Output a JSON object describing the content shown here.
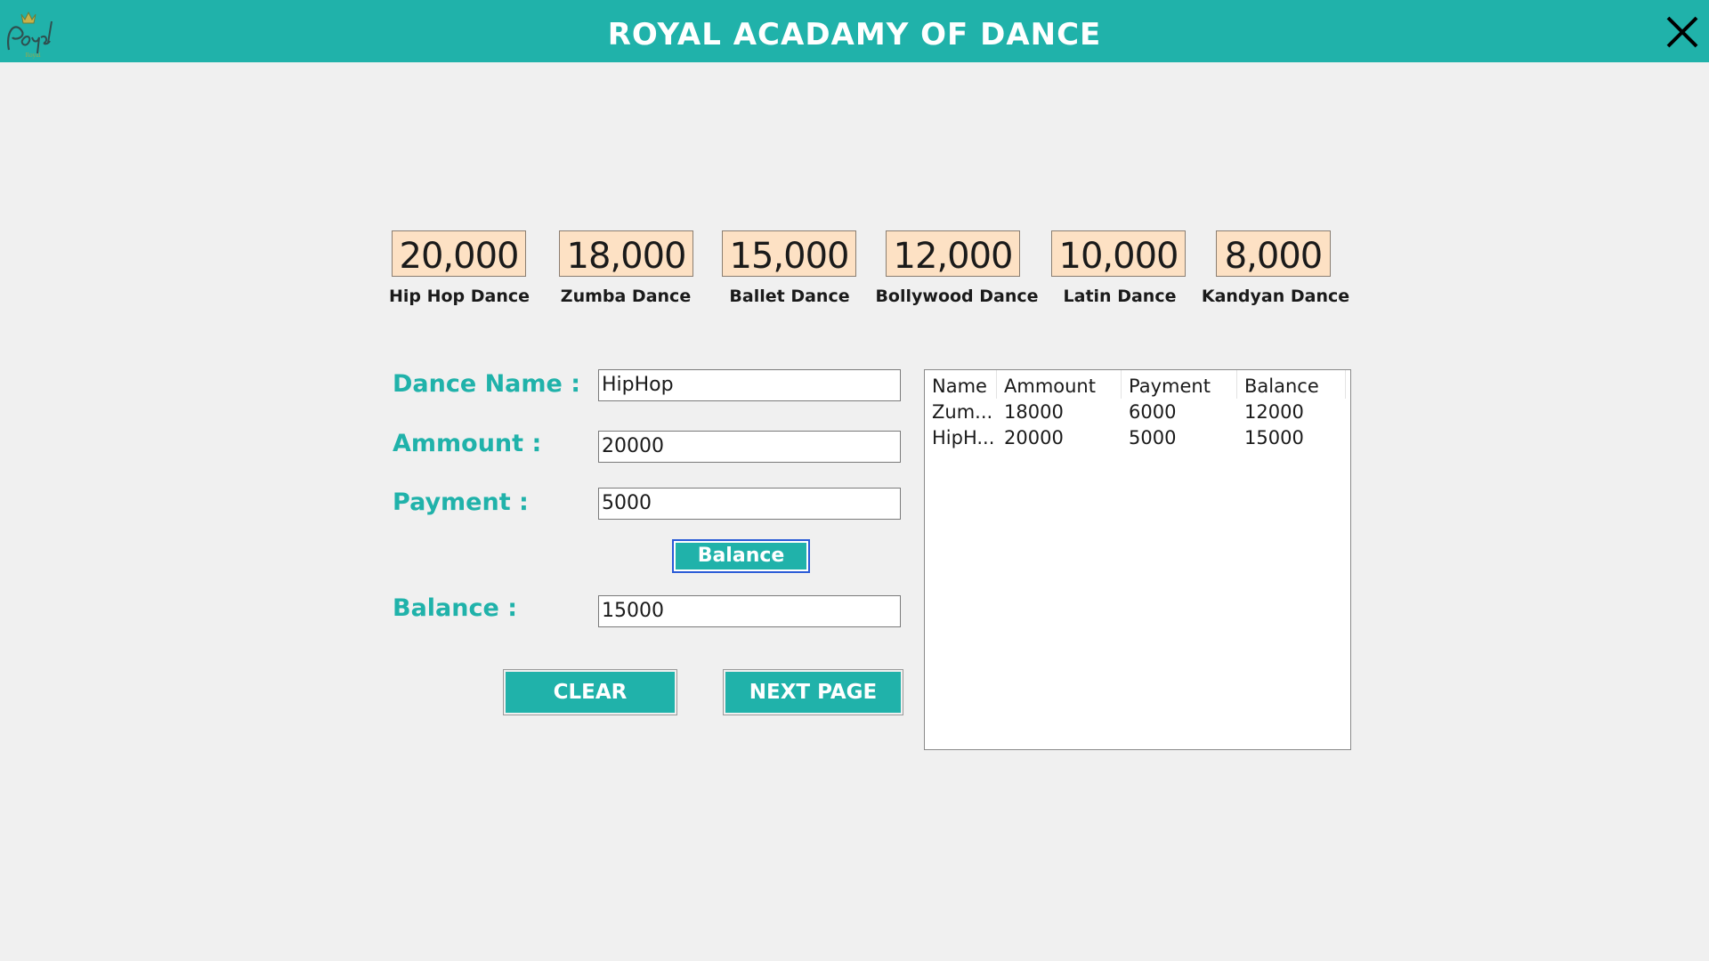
{
  "window": {
    "title": "ROYAL ACADAMY OF DANCE",
    "logo_text": "Royal",
    "accent_color": "#20b2aa",
    "close_icon": "close-icon"
  },
  "price_cards": [
    {
      "price": "20,000",
      "label": "Hip Hop Dance"
    },
    {
      "price": "18,000",
      "label": "Zumba Dance"
    },
    {
      "price": "15,000",
      "label": "Ballet Dance"
    },
    {
      "price": "12,000",
      "label": "Bollywood Dance"
    },
    {
      "price": "10,000",
      "label": "Latin Dance"
    },
    {
      "price": "8,000",
      "label": "Kandyan Dance"
    }
  ],
  "form": {
    "dance_name_label": "Dance Name :",
    "dance_name_value": "HipHop",
    "amount_label": "Ammount :",
    "amount_value": "20000",
    "payment_label": "Payment :",
    "payment_value": "5000",
    "balance_button": "Balance",
    "balance_label": "Balance :",
    "balance_value": "15000"
  },
  "buttons": {
    "clear": "CLEAR",
    "next_page": "NEXT PAGE"
  },
  "table": {
    "columns": [
      "Name",
      "Ammount",
      "Payment",
      "Balance"
    ],
    "rows": [
      [
        "Zum...",
        "18000",
        "6000",
        "12000"
      ],
      [
        "HipH...",
        "20000",
        "5000",
        "15000"
      ]
    ]
  }
}
